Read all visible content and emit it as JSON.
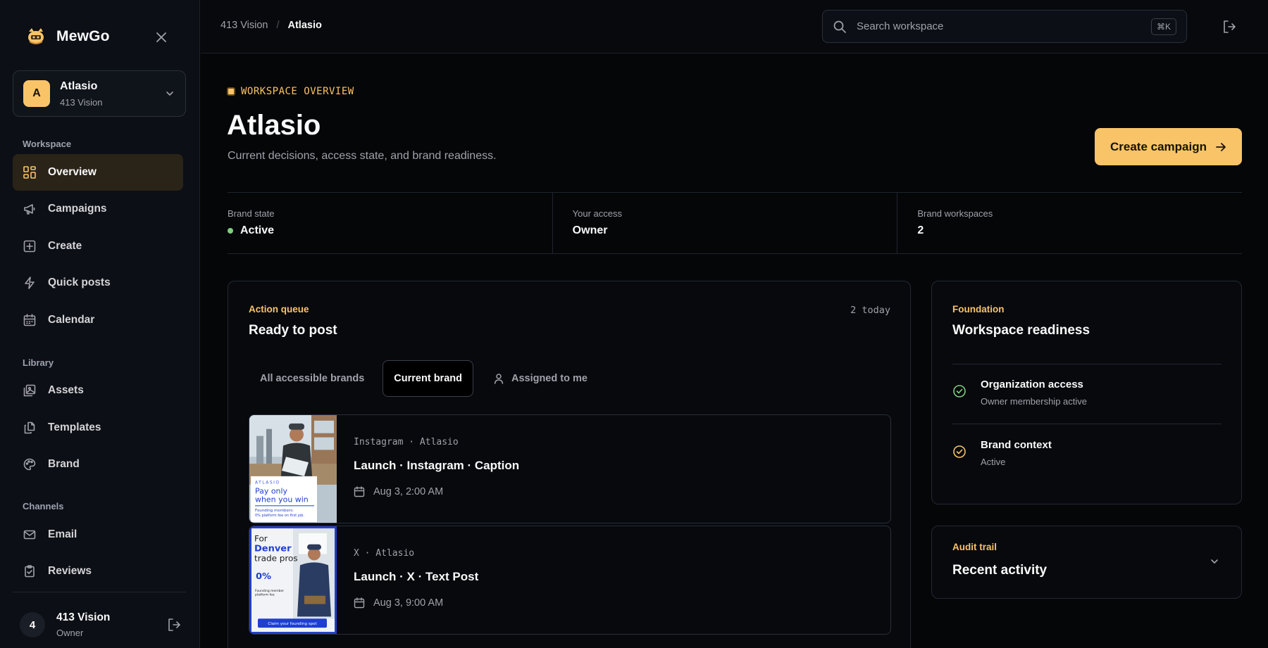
{
  "app": {
    "name": "MewGo"
  },
  "workspace_switcher": {
    "avatar_letter": "A",
    "name": "Atlasio",
    "org": "413 Vision"
  },
  "sidebar": {
    "sections": {
      "workspace": "Workspace",
      "library": "Library",
      "channels": "Channels"
    },
    "items": [
      {
        "label": "Overview",
        "icon": "grid-icon",
        "active": true
      },
      {
        "label": "Campaigns",
        "icon": "megaphone-icon"
      },
      {
        "label": "Create",
        "icon": "plus-square-icon"
      },
      {
        "label": "Quick posts",
        "icon": "lightning-icon"
      },
      {
        "label": "Calendar",
        "icon": "calendar-icon"
      },
      {
        "label": "Assets",
        "icon": "image-stack-icon"
      },
      {
        "label": "Templates",
        "icon": "copy-icon"
      },
      {
        "label": "Brand",
        "icon": "palette-icon"
      },
      {
        "label": "Email",
        "icon": "mail-icon"
      },
      {
        "label": "Reviews",
        "icon": "clipboard-check-icon"
      }
    ],
    "user": {
      "avatar_letter": "4",
      "name": "413 Vision",
      "role": "Owner"
    }
  },
  "topbar": {
    "breadcrumb": {
      "parent": "413 Vision",
      "separator": "/",
      "current": "Atlasio"
    },
    "search": {
      "placeholder": "Search workspace",
      "shortcut": "⌘K"
    }
  },
  "header": {
    "eyebrow": "WORKSPACE OVERVIEW",
    "title": "Atlasio",
    "subtitle": "Current decisions, access state, and brand readiness.",
    "cta_label": "Create campaign"
  },
  "stats": [
    {
      "label": "Brand state",
      "value": "Active"
    },
    {
      "label": "Your access",
      "value": "Owner"
    },
    {
      "label": "Brand workspaces",
      "value": "2"
    }
  ],
  "queue": {
    "eyebrow": "Action queue",
    "title": "Ready to post",
    "count": "2 today",
    "tabs": [
      {
        "label": "All accessible brands"
      },
      {
        "label": "Current brand",
        "active": true
      },
      {
        "label": "Assigned to me",
        "icon": "user-icon"
      }
    ],
    "posts": [
      {
        "meta": "Instagram · Atlasio",
        "title": "Launch · Instagram · Caption",
        "date": "Aug 3, 2:00 AM",
        "thumb": {
          "brand": "ATLASIO",
          "headline1": "Pay only",
          "headline2": "when you win",
          "fine1": "Founding members:",
          "fine2": "0% platform fee on first job."
        }
      },
      {
        "meta": "X · Atlasio",
        "title": "Launch · X · Text Post",
        "date": "Aug 3, 9:00 AM",
        "thumb": {
          "line1": "For",
          "line2": "Denver",
          "line3": "trade pros",
          "pct": "0%",
          "fine1": "Founding member",
          "fine2": "platform fee",
          "button": "Claim your founding spot"
        }
      }
    ]
  },
  "readiness": {
    "eyebrow": "Foundation",
    "title": "Workspace readiness",
    "items": [
      {
        "title": "Organization access",
        "sub": "Owner membership active",
        "color": "#7ecf7e"
      },
      {
        "title": "Brand context",
        "sub": "Active",
        "color": "#f9c468"
      }
    ]
  },
  "audit": {
    "eyebrow": "Audit trail",
    "title": "Recent activity"
  },
  "colors": {
    "accent": "#f9c468",
    "success": "#7ecf7e",
    "background": "#050608"
  }
}
